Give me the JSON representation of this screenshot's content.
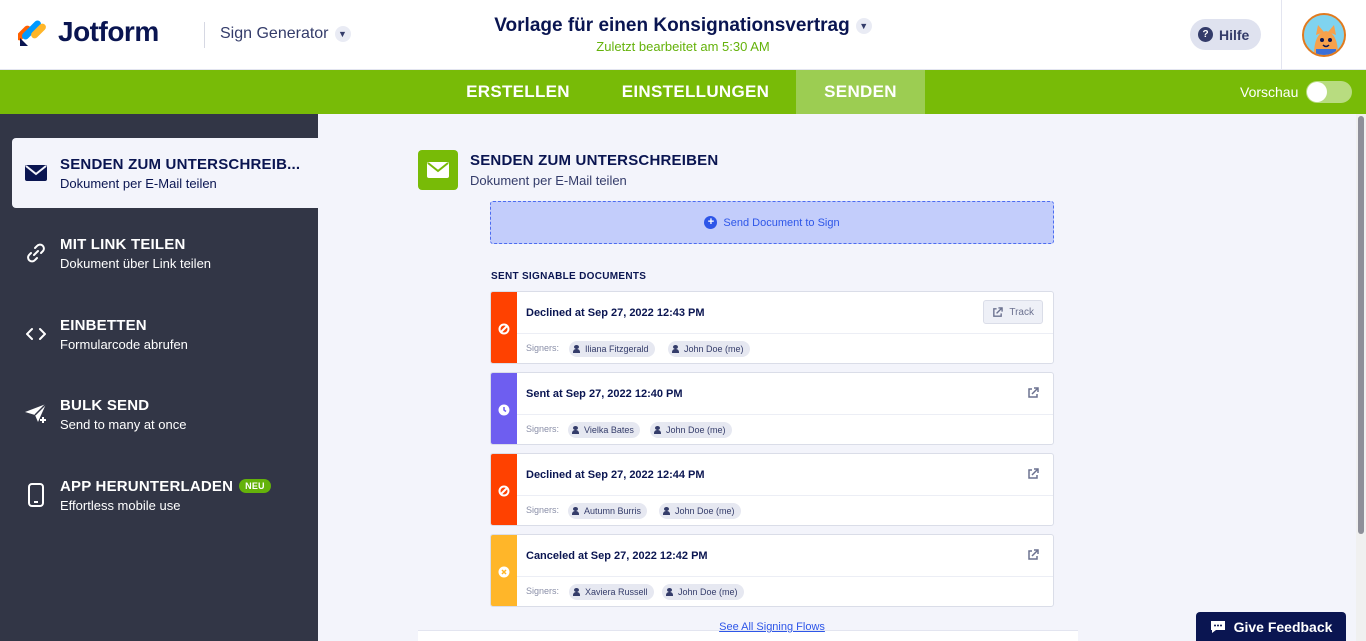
{
  "header": {
    "brand": "Jotform",
    "app_name": "Sign Generator",
    "doc_title": "Vorlage für einen Konsignationsvertrag",
    "last_edited": "Zuletzt bearbeitet am 5:30 AM",
    "help_label": "Hilfe"
  },
  "nav": {
    "tabs": [
      "ERSTELLEN",
      "EINSTELLUNGEN",
      "SENDEN"
    ],
    "active_tab": "SENDEN",
    "preview_label": "Vorschau",
    "preview_on": false
  },
  "sidebar": {
    "items": [
      {
        "title": "SENDEN ZUM UNTERSCHREIB...",
        "desc": "Dokument per E-Mail teilen",
        "icon": "envelope-icon",
        "active": true
      },
      {
        "title": "MIT LINK TEILEN",
        "desc": "Dokument über Link teilen",
        "icon": "link-icon",
        "active": false
      },
      {
        "title": "EINBETTEN",
        "desc": "Formularcode abrufen",
        "icon": "code-icon",
        "active": false
      },
      {
        "title": "BULK SEND",
        "desc": "Send to many at once",
        "icon": "paper-plane-icon",
        "active": false
      },
      {
        "title": "APP HERUNTERLADEN",
        "desc": "Effortless mobile use",
        "icon": "phone-icon",
        "active": false,
        "badge": "NEU"
      }
    ]
  },
  "main": {
    "section_title": "SENDEN ZUM UNTERSCHREIBEN",
    "section_desc": "Dokument per E-Mail teilen",
    "send_button": "Send Document to Sign",
    "list_heading": "SENT SIGNABLE DOCUMENTS",
    "signers_label": "Signers:",
    "track_label": "Track",
    "see_all": "See All Signing Flows",
    "documents": [
      {
        "status": "Declined at Sep 27, 2022 12:43 PM",
        "state": "declined",
        "color": "#ff4100",
        "signers": [
          "Iliana Fitzgerald",
          "John Doe (me)"
        ]
      },
      {
        "status": "Sent at Sep 27, 2022 12:40 PM",
        "state": "sent",
        "color": "#6e5ef0",
        "signers": [
          "Vielka Bates",
          "John Doe (me)"
        ]
      },
      {
        "status": "Declined at Sep 27, 2022 12:44 PM",
        "state": "declined",
        "color": "#ff4100",
        "signers": [
          "Autumn Burris",
          "John Doe (me)"
        ]
      },
      {
        "status": "Canceled at Sep 27, 2022 12:42 PM",
        "state": "canceled",
        "color": "#ffb629",
        "signers": [
          "Xaviera Russell",
          "John Doe (me)"
        ]
      }
    ]
  },
  "feedback_label": "Give Feedback",
  "colors": {
    "brand_green": "#78bb07",
    "navy": "#0a1551",
    "sidebar_bg": "#323646",
    "accent_blue": "#2e56e8"
  }
}
